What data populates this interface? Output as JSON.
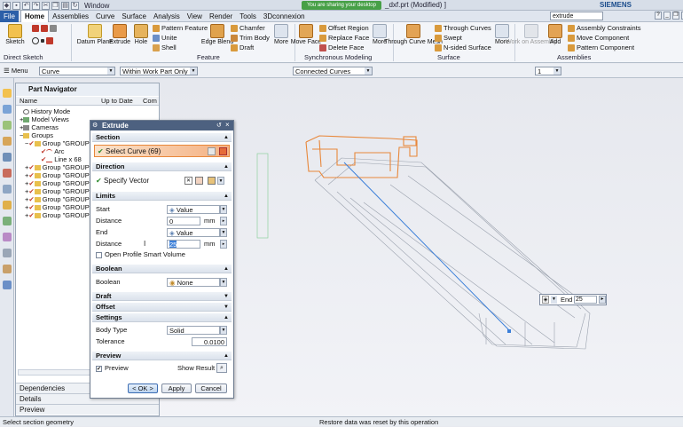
{
  "titlebar": {
    "window_menu": "Window",
    "share_banner": "You are sharing your desktop",
    "doc_title": "_dxf.prt (Modified) ]",
    "brand": "SIEMENS"
  },
  "menubar": {
    "tabs": [
      "File",
      "Home",
      "Assemblies",
      "Curve",
      "Surface",
      "Analysis",
      "View",
      "Render",
      "Tools",
      "3Dconnexion"
    ],
    "search": "extrude"
  },
  "ribbon": {
    "direct_sketch": {
      "label": "Direct Sketch",
      "sketch": "Sketch"
    },
    "feature": {
      "label": "Feature",
      "datum_plane": "Datum Plane",
      "extrude": "Extrude",
      "hole": "Hole",
      "pattern_feature": "Pattern Feature",
      "unite": "Unite",
      "shell": "Shell",
      "edge_blend": "Edge Blend",
      "chamfer": "Chamfer",
      "trim_body": "Trim Body",
      "draft": "Draft",
      "more": "More"
    },
    "sync": {
      "label": "Synchronous Modeling",
      "move_face": "Move Face",
      "offset_region": "Offset Region",
      "replace_face": "Replace Face",
      "delete_face": "Delete Face",
      "more": "More"
    },
    "surface": {
      "label": "Surface",
      "through_curve_mesh": "Through Curve Mesh",
      "through_curves": "Through Curves",
      "swept": "Swept",
      "n_sided": "N-sided Surface",
      "more": "More"
    },
    "assemblies": {
      "label": "Assemblies",
      "work_on_assembly": "Work on Assembly",
      "add": "Add",
      "constraints": "Assembly Constraints",
      "move_component": "Move Component",
      "pattern_component": "Pattern Component"
    }
  },
  "selbar": {
    "menu": "Menu",
    "filter": "Curve",
    "scope": "Within Work Part Only",
    "rule": "Connected Curves",
    "count": "1"
  },
  "navigator": {
    "title": "Part Navigator",
    "columns": [
      "Name",
      "Up to Date",
      "Com"
    ],
    "rows": [
      "History Mode",
      "Model Views",
      "Cameras",
      "Groups",
      "Group \"GROUP",
      "Arc",
      "Line x 68",
      "Group \"GROUP",
      "Group \"GROUP",
      "Group \"GROUP",
      "Group \"GROUP",
      "Group \"GROUP",
      "Group \"GROUP",
      "Group \"GROUP"
    ],
    "bottom": [
      "Dependencies",
      "Details",
      "Preview"
    ]
  },
  "dialog": {
    "title": "Extrude",
    "section": {
      "header": "Section",
      "select_curve": "Select Curve (69)"
    },
    "direction": {
      "header": "Direction",
      "specify_vector": "Specify Vector"
    },
    "limits": {
      "header": "Limits",
      "start_label": "Start",
      "start_value": "Value",
      "distance1_label": "Distance",
      "distance1_value": "0",
      "end_label": "End",
      "end_value": "Value",
      "distance2_label": "Distance",
      "distance2_value": "25",
      "unit": "mm",
      "open_profile": "Open Profile Smart Volume"
    },
    "boolean": {
      "header": "Boolean",
      "label": "Boolean",
      "value": "None"
    },
    "draft": {
      "header": "Draft"
    },
    "offset": {
      "header": "Offset"
    },
    "settings": {
      "header": "Settings",
      "body_type_label": "Body Type",
      "body_type_value": "Solid",
      "tolerance_label": "Tolerance",
      "tolerance_value": "0.0100"
    },
    "preview": {
      "header": "Preview",
      "preview_label": "Preview",
      "show_result": "Show Result"
    },
    "buttons": {
      "ok": "< OK >",
      "apply": "Apply",
      "cancel": "Cancel"
    }
  },
  "end_tip": {
    "label": "End",
    "value": "25"
  },
  "status": {
    "left": "Select section geometry",
    "center": "Restore data was reset by this operation"
  },
  "colors": {
    "accent": "#2c5fa8",
    "select_orange": "#f4b183",
    "curve_orange": "#e8873a",
    "preview_blue": "#3b7fd9"
  }
}
